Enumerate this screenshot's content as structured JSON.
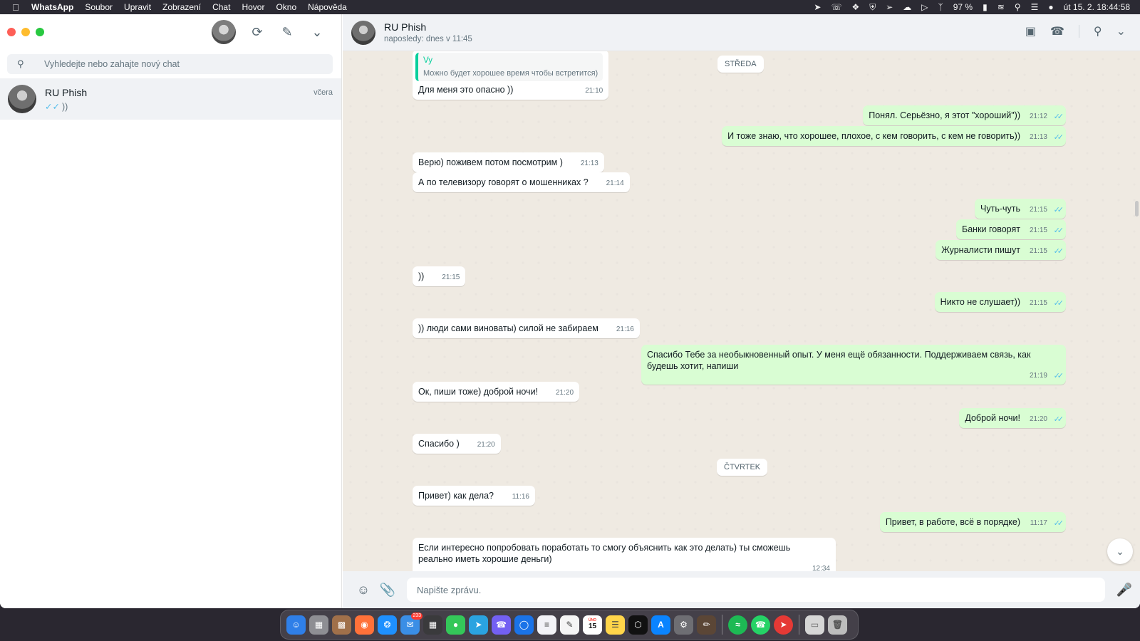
{
  "menubar": {
    "app_name": "WhatsApp",
    "items": [
      "Soubor",
      "Upravit",
      "Zobrazení",
      "Chat",
      "Hovor",
      "Okno",
      "Nápověda"
    ],
    "battery": "97 %",
    "clock": "út 15. 2.  18:44:58"
  },
  "sidebar": {
    "search_placeholder": "Vyhledejte nebo zahajte nový chat",
    "chats": [
      {
        "name": "RU Phish",
        "preview": "))",
        "time": "včera"
      }
    ]
  },
  "conversation": {
    "name": "RU Phish",
    "status": "naposledy: dnes v 11:45",
    "composer_placeholder": "Napište zprávu.",
    "day_labels": [
      "STŘEDA",
      "ČTVRTEK"
    ],
    "messages": [
      {
        "dir": "in",
        "quote_author": "Vy",
        "quote_text": "Можно будет хорошее время чтобы встретится)",
        "text": "Для меня это опасно ))",
        "time": "21:10"
      },
      {
        "dir": "out",
        "text": "Понял. Серьёзно, я этот \"хороший\"))",
        "time": "21:12"
      },
      {
        "dir": "out",
        "text": "И тоже знаю, что хорошее, плохое, с кем говорить, с кем не говорить))",
        "time": "21:13"
      },
      {
        "dir": "in",
        "text": "Верю) поживем потом посмотрим )",
        "time": "21:13"
      },
      {
        "dir": "in",
        "text": "А по телевизору говорят о мошенниках ?",
        "time": "21:14"
      },
      {
        "dir": "out",
        "text": "Чуть-чуть",
        "time": "21:15"
      },
      {
        "dir": "out",
        "text": "Банки говорят",
        "time": "21:15"
      },
      {
        "dir": "out",
        "text": "Журналисти пишут",
        "time": "21:15"
      },
      {
        "dir": "in",
        "text": "))",
        "time": "21:15"
      },
      {
        "dir": "out",
        "text": "Никто не слушает))",
        "time": "21:15"
      },
      {
        "dir": "in",
        "text": ")) люди сами виноваты) силой не забираем",
        "time": "21:16"
      },
      {
        "dir": "out",
        "text": "Спасибо Тебе за необыкновенный опыт. У меня ещё обязанности. Поддерживаем связь, как будешь хотит,  напиши",
        "time": "21:19"
      },
      {
        "dir": "in",
        "text": "Ок, пиши тоже) доброй ночи!",
        "time": "21:20"
      },
      {
        "dir": "out",
        "text": "Доброй ночи!",
        "time": "21:20"
      },
      {
        "dir": "in",
        "text": "Спасибо )",
        "time": "21:20"
      },
      {
        "dir": "in",
        "text": "Привет) как дела?",
        "time": "11:16"
      },
      {
        "dir": "out",
        "text": "Привет, в работе, всё в порядке)",
        "time": "11:17"
      },
      {
        "dir": "in",
        "text": "Если интересно попробовать поработать то смогу объяснить как это делать)  ты сможешь реально иметь хорошие деньги)",
        "time": "12:34"
      }
    ]
  },
  "dock": {
    "mail_badge": "233",
    "calendar_day": "15",
    "calendar_month": "ÚNO"
  },
  "colors": {
    "outgoing_bubble": "#d9fdd3",
    "incoming_bubble": "#ffffff",
    "chat_bg": "#efeae2",
    "read_ticks": "#53bdeb"
  }
}
